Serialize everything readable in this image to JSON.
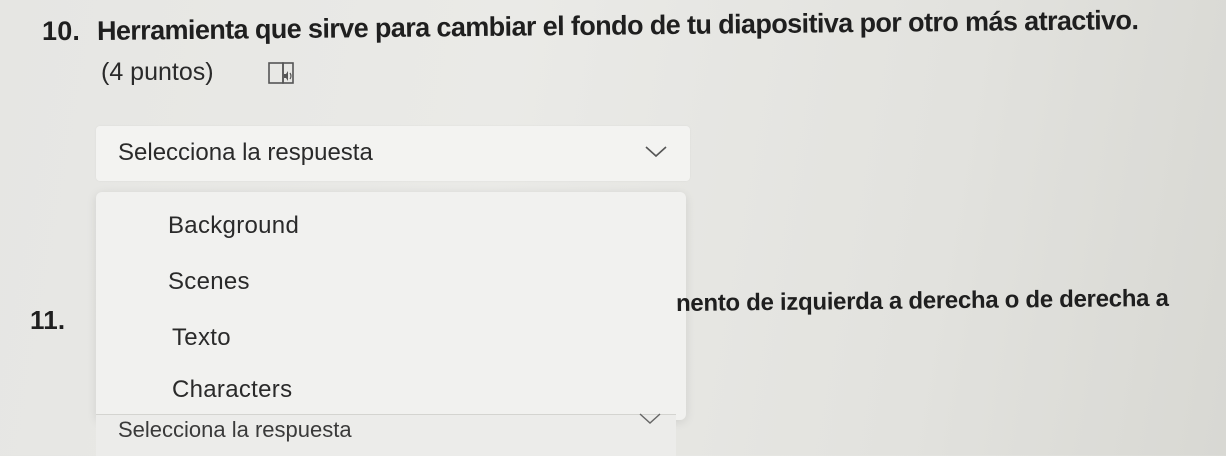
{
  "question10": {
    "number": "10.",
    "text": "Herramienta que sirve para cambiar el fondo de tu diapositiva por otro más atractivo.",
    "points": "(4 puntos)",
    "reader_icon": "immersive-reader-icon",
    "select": {
      "placeholder": "Selecciona la respuesta",
      "chevron_icon": "chevron-down-icon"
    },
    "options": [
      "Background",
      "Scenes",
      "Texto",
      "Characters"
    ]
  },
  "question11": {
    "number": "11.",
    "visible_text": "nento de izquierda a derecha o de derecha a",
    "select": {
      "placeholder": "Selecciona la respuesta",
      "chevron_icon": "chevron-down-icon"
    }
  }
}
